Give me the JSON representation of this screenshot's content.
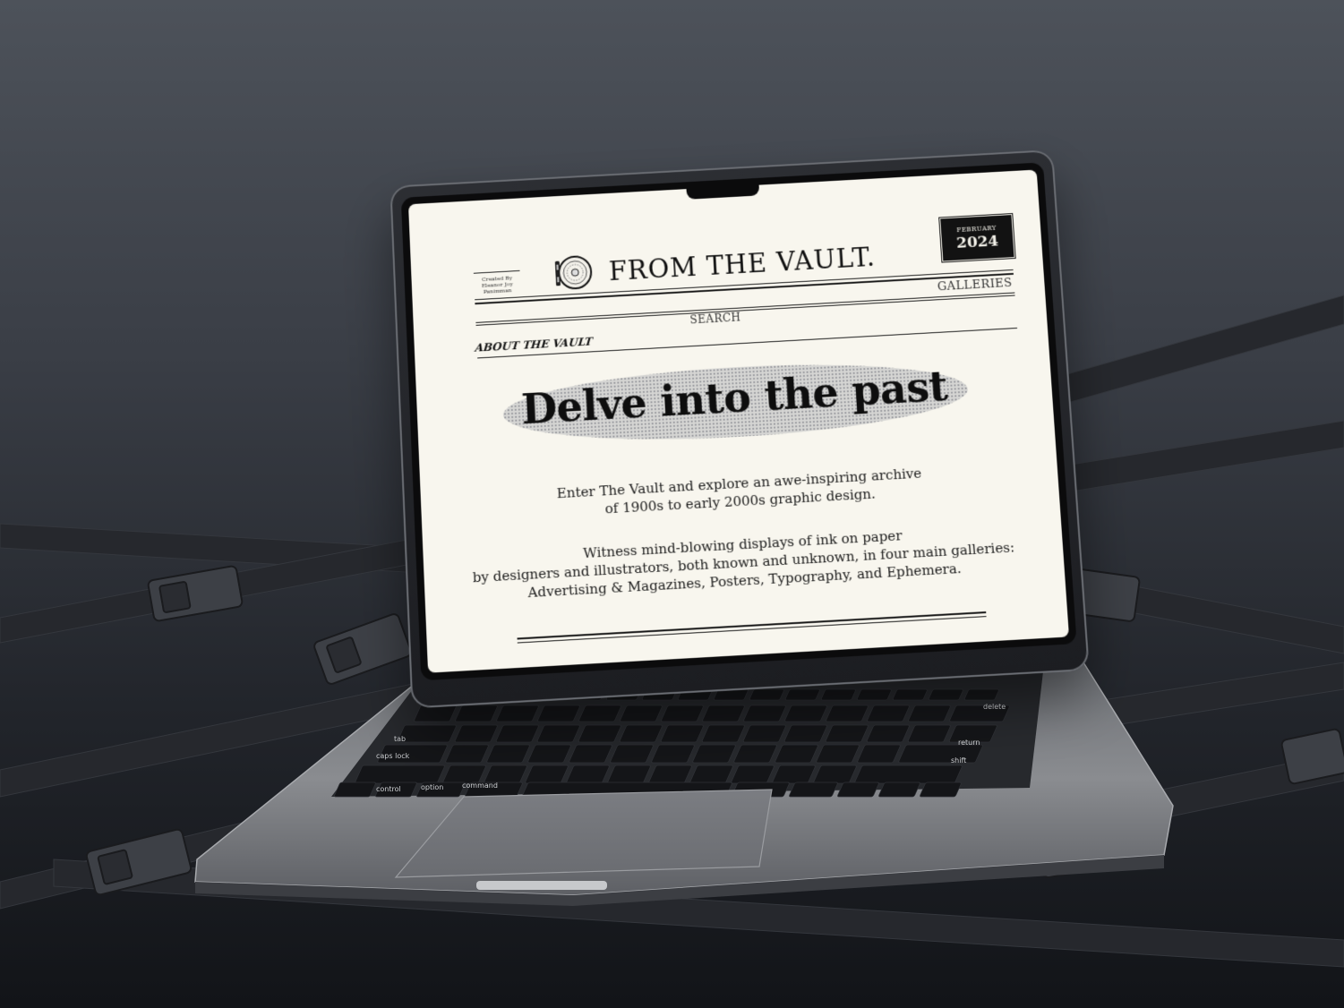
{
  "site": {
    "credit": [
      "Created By",
      "Eleanor Joy",
      "Panimman"
    ],
    "title": "FROM THE VAULT.",
    "date_badge": {
      "month": "FEBRUARY",
      "year": "2024"
    },
    "nav": {
      "about": "ABOUT THE VAULT",
      "search": "SEARCH",
      "galleries": "GALLERIES"
    },
    "hero": {
      "title": "Delve into the past",
      "intro_lines": [
        "Enter The Vault and explore an awe-inspiring archive",
        "of 1900s to early 2000s graphic design."
      ],
      "body_lines": [
        "Witness mind-blowing displays of ink on paper",
        "by designers and illustrators, both known and unknown, in four main galleries:",
        "Advertising & Magazines, Posters, Typography, and Ephemera."
      ]
    }
  },
  "keyboard": {
    "keys": [
      "delete",
      "return",
      "shift",
      "caps lock",
      "tab",
      "control",
      "option",
      "command"
    ]
  },
  "colors": {
    "background_top": "#4d525a",
    "background_bottom": "#121418",
    "paper": "#f8f6ee",
    "ink": "#111111",
    "laptop_body": "#8b8d91"
  }
}
